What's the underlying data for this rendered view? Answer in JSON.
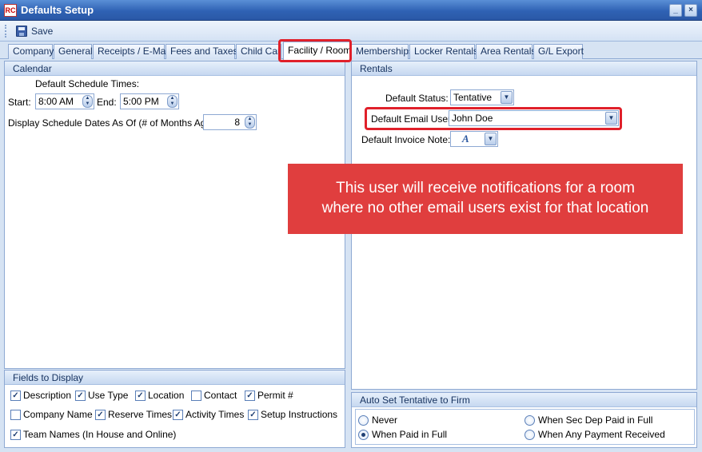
{
  "window": {
    "title": "Defaults Setup",
    "app_icon": "RC",
    "minimize": "_",
    "close": "×"
  },
  "toolbar": {
    "save_label": "Save"
  },
  "tabs": [
    {
      "label": "Company"
    },
    {
      "label": "General"
    },
    {
      "label": "Receipts / E-Mail"
    },
    {
      "label": "Fees and Taxes"
    },
    {
      "label": "Child Care"
    },
    {
      "label": "Facility / Room"
    },
    {
      "label": "Memberships"
    },
    {
      "label": "Locker Rentals"
    },
    {
      "label": "Area Rentals"
    },
    {
      "label": "G/L Export"
    }
  ],
  "active_tab": "Facility / Room",
  "calendar": {
    "header": "Calendar",
    "default_times_label": "Default Schedule Times:",
    "start_label": "Start:",
    "start_value": "8:00 AM",
    "end_label": "End:",
    "end_value": "5:00 PM",
    "months_label": "Display Schedule Dates As Of (# of Months Ago):",
    "months_value": "8"
  },
  "fields": {
    "header": "Fields to Display",
    "items": [
      {
        "label": "Description",
        "checked": true
      },
      {
        "label": "Use Type",
        "checked": true
      },
      {
        "label": "Location",
        "checked": true
      },
      {
        "label": "Contact",
        "checked": false
      },
      {
        "label": "Permit #",
        "checked": true
      },
      {
        "label": "Company Name",
        "checked": false
      },
      {
        "label": "Reserve Times",
        "checked": true
      },
      {
        "label": "Activity Times",
        "checked": true
      },
      {
        "label": "Setup Instructions",
        "checked": true
      },
      {
        "label": "Team Names (In House and Online)",
        "checked": true
      }
    ]
  },
  "rentals": {
    "header": "Rentals",
    "status_label": "Default Status:",
    "status_value": "Tentative",
    "email_label": "Default Email User:",
    "email_value": "John Doe",
    "invoice_label": "Default Invoice Note:"
  },
  "auto_set": {
    "header": "Auto Set Tentative to Firm",
    "options": [
      {
        "label": "Never",
        "selected": false
      },
      {
        "label": "When Paid in Full",
        "selected": true
      },
      {
        "label": "When Sec Dep Paid in Full",
        "selected": false
      },
      {
        "label": "When Any Payment Received",
        "selected": false
      }
    ]
  },
  "callout": {
    "line1": "This user will receive notifications for a room",
    "line2": "where no other email users exist for that location"
  },
  "colors": {
    "highlight": "#e0202a",
    "callout": "#e03e3e",
    "title_bar": "#2f62b4"
  }
}
